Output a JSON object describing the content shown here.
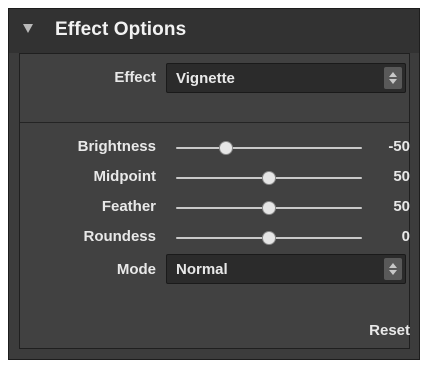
{
  "panel": {
    "title": "Effect Options",
    "collapse_icon": "disclosure-triangle-down-icon"
  },
  "effect": {
    "label": "Effect",
    "value": "Vignette",
    "stepper_icon": "up-down-stepper-icon"
  },
  "sliders": [
    {
      "key": "brightness",
      "label": "Brightness",
      "value": "-50",
      "fraction": 0.27
    },
    {
      "key": "midpoint",
      "label": "Midpoint",
      "value": "50",
      "fraction": 0.5
    },
    {
      "key": "feather",
      "label": "Feather",
      "value": "50",
      "fraction": 0.5
    },
    {
      "key": "roundness",
      "label": "Roundess",
      "value": "0",
      "fraction": 0.5
    }
  ],
  "mode": {
    "label": "Mode",
    "value": "Normal",
    "stepper_icon": "up-down-stepper-icon"
  },
  "reset_label": "Reset",
  "colors": {
    "panel_bg": "#3c3c3c",
    "header_bg": "#323232",
    "text": "#e8e8e8",
    "thumb": "#e6e6e6"
  }
}
